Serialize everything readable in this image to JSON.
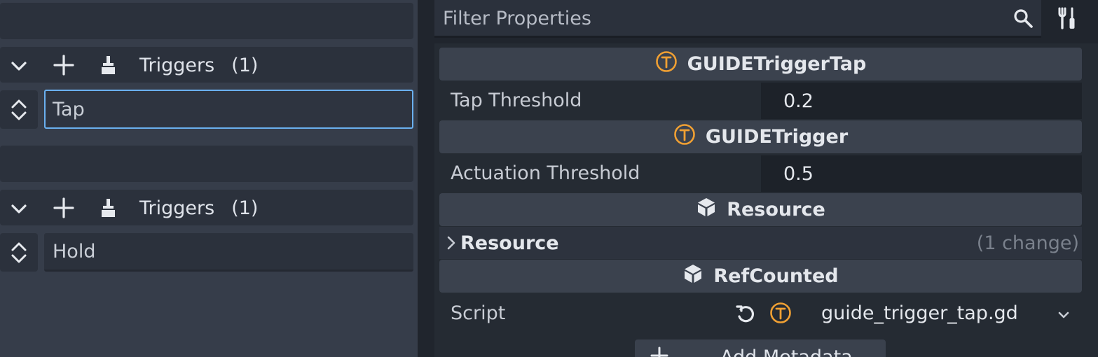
{
  "left": {
    "groups": [
      {
        "header_label": "Triggers",
        "header_count": "(1)",
        "item_value": "Tap"
      },
      {
        "header_label": "Triggers",
        "header_count": "(1)",
        "item_value": "Hold"
      }
    ]
  },
  "inspector": {
    "filter_placeholder": "Filter Properties",
    "sections": {
      "s1": "GUIDETriggerTap",
      "s2": "GUIDETrigger",
      "s3": "Resource",
      "s4": "RefCounted"
    },
    "props": {
      "tap_threshold_label": "Tap Threshold",
      "tap_threshold_value": "0.2",
      "actuation_threshold_label": "Actuation Threshold",
      "actuation_threshold_value": "0.5"
    },
    "resource_group": {
      "label": "Resource",
      "changes": "(1 change)"
    },
    "script": {
      "label": "Script",
      "value": "guide_trigger_tap.gd"
    },
    "add_metadata_label": "Add Metadata"
  },
  "colors": {
    "accent": "#6ab0ef",
    "script_icon": "#f0a033"
  }
}
